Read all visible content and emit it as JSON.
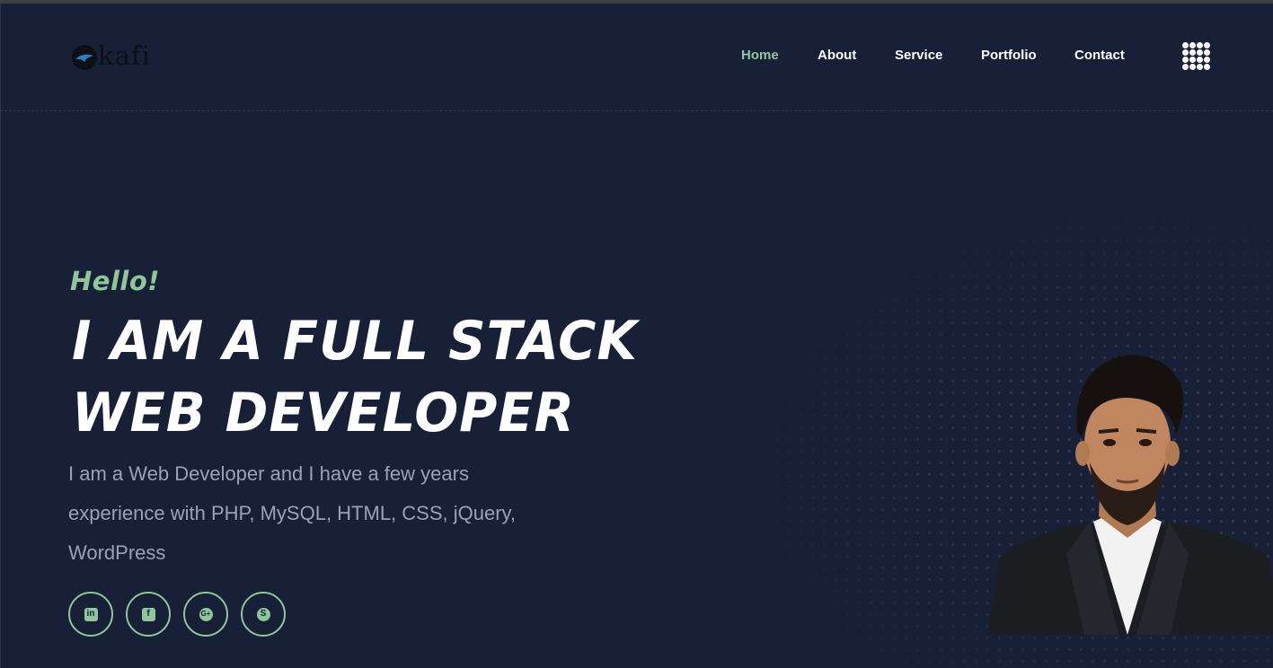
{
  "brand": {
    "logo_text": "kafi"
  },
  "nav": {
    "items": [
      {
        "label": "Home",
        "active": true
      },
      {
        "label": "About",
        "active": false
      },
      {
        "label": "Service",
        "active": false
      },
      {
        "label": "Portfolio",
        "active": false
      },
      {
        "label": "Contact",
        "active": false
      }
    ],
    "menu_icon": "grid-menu-icon"
  },
  "hero": {
    "greeting": "Hello!",
    "headline_line1": "I AM A FULL STACK",
    "headline_line2": "WEB DEVELOPER",
    "intro_line1": "I am a Web Developer and I have a few years",
    "intro_line2": "experience with PHP, MySQL, HTML, CSS, jQuery,",
    "intro_line3": "WordPress"
  },
  "social": [
    {
      "icon": "linkedin-icon",
      "glyph": "in"
    },
    {
      "icon": "facebook-icon",
      "glyph": "f"
    },
    {
      "icon": "google-plus-icon",
      "glyph": "G+"
    },
    {
      "icon": "skype-icon",
      "glyph": "S"
    }
  ],
  "colors": {
    "background": "#172036",
    "accent": "#8fc79a",
    "text_primary": "#ffffff",
    "text_secondary": "#9aa3b2"
  }
}
